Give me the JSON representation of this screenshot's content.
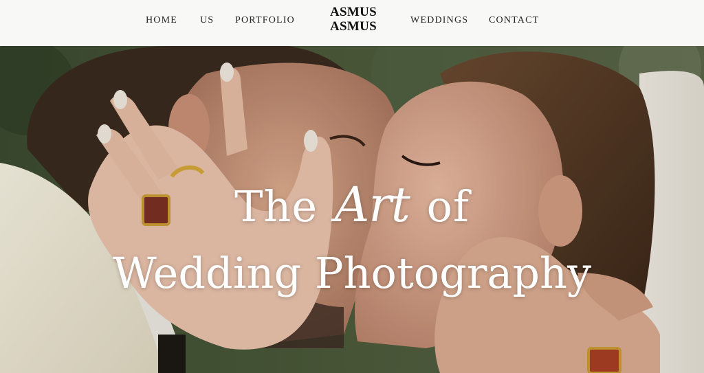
{
  "nav": {
    "left_items": [
      {
        "label": "HOME"
      },
      {
        "label": "US"
      },
      {
        "label": "PORTFOLIO"
      }
    ],
    "right_items": [
      {
        "label": "WEDDINGS"
      },
      {
        "label": "CONTACT"
      }
    ]
  },
  "logo": {
    "line1": "ASMUS",
    "line2": "ASMUS"
  },
  "hero": {
    "title_part1": "The",
    "title_art": "Art",
    "title_part2": "of",
    "title_line2": "Wedding Photography",
    "photo_subject": "couple-kissing-photo"
  },
  "colors": {
    "header_bg": "#f8f8f6",
    "text_dark": "#222222",
    "hero_text": "#ffffff"
  }
}
